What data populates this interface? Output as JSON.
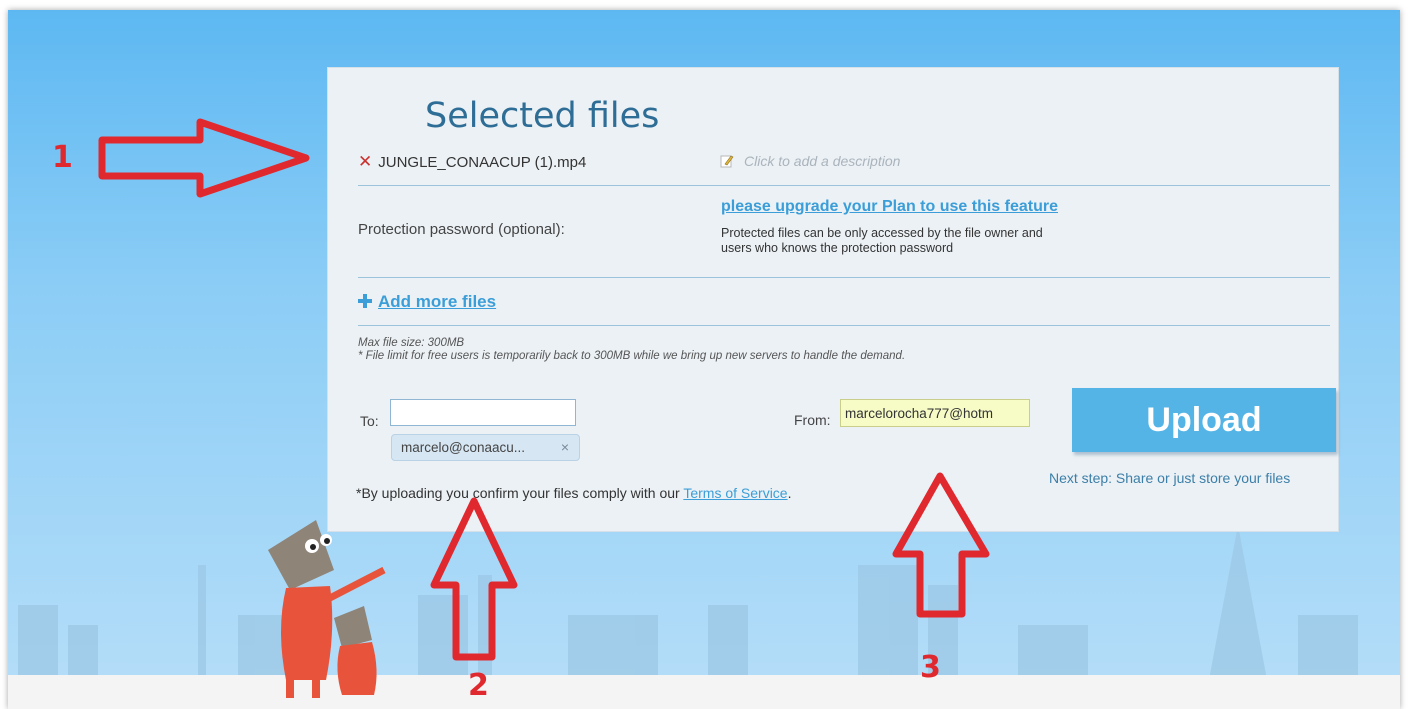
{
  "panel": {
    "title": "Selected files",
    "file": {
      "remove_icon": "close-icon",
      "name": "JUNGLE_CONAACUP (1).mp4",
      "description_placeholder": "Click to add a description"
    },
    "protection": {
      "label": "Protection password (optional):",
      "upgrade_link": "please upgrade your Plan to use this feature",
      "help_line1": "Protected files can be only accessed by the file owner and",
      "help_line2": "users who knows the protection password"
    },
    "add_more": "Add more files",
    "limits": {
      "max_size": "Max file size: 300MB",
      "notice": "* File limit for free users is temporarily back to 300MB while we bring up new servers to handle the demand."
    },
    "to": {
      "label": "To:",
      "value": "",
      "chip": "marcelo@conaacu...",
      "chip_remove": "×"
    },
    "from": {
      "label": "From:",
      "value": "marcelorocha777@hotm"
    },
    "upload_button": "Upload",
    "next_step": "Next step: Share or just store your files",
    "tos_prefix": "*By uploading you confirm your files comply with our",
    "tos_link": "Terms of Service",
    "tos_suffix": "."
  },
  "annotations": {
    "one": "1",
    "two": "2",
    "three": "3",
    "color": "#e0292f"
  },
  "colors": {
    "accent": "#3b9ed8",
    "title": "#2d6d96",
    "upload_bg": "#55b4e6",
    "from_bg": "#f7fbc6"
  }
}
